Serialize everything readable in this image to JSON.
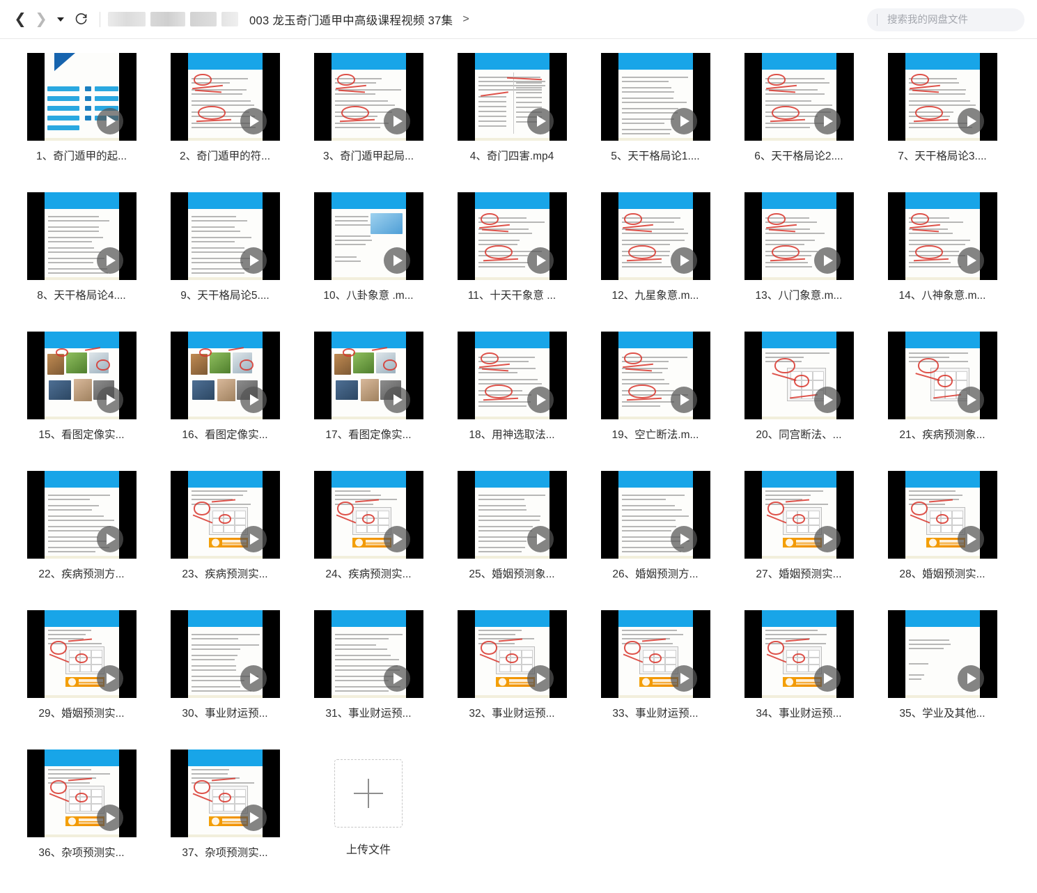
{
  "window": {
    "title": "003 龙玉奇门遁甲中高级课程视频 37集"
  },
  "toolbar": {
    "back_icon": "chevron-left-icon",
    "forward_icon": "chevron-right-icon",
    "history_caret_icon": "caret-down-icon",
    "refresh_icon": "refresh-icon",
    "breadcrumb_current": "003 龙玉奇门遁甲中高级课程视频 37集",
    "breadcrumb_next": ">",
    "path_redacted": true
  },
  "search": {
    "placeholder": "搜索我的网盘文件",
    "value": "",
    "icon": "search-input-divider"
  },
  "colors": {
    "slide_header_blue": "#18a5e8",
    "annotation_red": "#d8342a",
    "logo_orange": "#f3a008",
    "play_overlay": "#555555",
    "page_background": "#ffffff"
  },
  "upload": {
    "label": "上传文件",
    "icon": "plus-icon"
  },
  "files": [
    {
      "n": 1,
      "label": "1、奇门遁甲的起...",
      "style": "contents"
    },
    {
      "n": 2,
      "label": "2、奇门遁甲的符...",
      "style": "text-red"
    },
    {
      "n": 3,
      "label": "3、奇门遁甲起局...",
      "style": "text-red"
    },
    {
      "n": 4,
      "label": "4、奇门四害.mp4",
      "style": "two-col"
    },
    {
      "n": 5,
      "label": "5、天干格局论1....",
      "style": "text-plain"
    },
    {
      "n": 6,
      "label": "6、天干格局论2....",
      "style": "text-red"
    },
    {
      "n": 7,
      "label": "7、天干格局论3....",
      "style": "text-red"
    },
    {
      "n": 8,
      "label": "8、天干格局论4....",
      "style": "text-plain"
    },
    {
      "n": 9,
      "label": "9、天干格局论5....",
      "style": "text-plain"
    },
    {
      "n": 10,
      "label": "10、八卦象意 .m...",
      "style": "photo-sky"
    },
    {
      "n": 11,
      "label": "11、十天干象意 ...",
      "style": "text-red"
    },
    {
      "n": 12,
      "label": "12、九星象意.m...",
      "style": "text-red"
    },
    {
      "n": 13,
      "label": "13、八门象意.m...",
      "style": "text-red"
    },
    {
      "n": 14,
      "label": "14、八神象意.m...",
      "style": "text-red"
    },
    {
      "n": 15,
      "label": "15、看图定像实...",
      "style": "photo-grid"
    },
    {
      "n": 16,
      "label": "16、看图定像实...",
      "style": "photo-grid"
    },
    {
      "n": 17,
      "label": "17、看图定像实...",
      "style": "photo-grid"
    },
    {
      "n": 18,
      "label": "18、用神选取法...",
      "style": "text-red"
    },
    {
      "n": 19,
      "label": "19、空亡断法.m...",
      "style": "text-red"
    },
    {
      "n": 20,
      "label": "20、同宫断法、...",
      "style": "chart-red"
    },
    {
      "n": 21,
      "label": "21、疾病预测象...",
      "style": "chart-red"
    },
    {
      "n": 22,
      "label": "22、疾病预测方...",
      "style": "text-plain"
    },
    {
      "n": 23,
      "label": "23、疾病预测实...",
      "style": "chart-logo"
    },
    {
      "n": 24,
      "label": "24、疾病预测实...",
      "style": "chart-logo"
    },
    {
      "n": 25,
      "label": "25、婚姻预测象...",
      "style": "text-plain"
    },
    {
      "n": 26,
      "label": "26、婚姻预测方...",
      "style": "text-plain"
    },
    {
      "n": 27,
      "label": "27、婚姻预测实...",
      "style": "chart-logo"
    },
    {
      "n": 28,
      "label": "28、婚姻预测实...",
      "style": "chart-logo"
    },
    {
      "n": 29,
      "label": "29、婚姻预测实...",
      "style": "chart-logo"
    },
    {
      "n": 30,
      "label": "30、事业财运预...",
      "style": "text-plain"
    },
    {
      "n": 31,
      "label": "31、事业财运预...",
      "style": "text-plain"
    },
    {
      "n": 32,
      "label": "32、事业财运预...",
      "style": "chart-logo"
    },
    {
      "n": 33,
      "label": "33、事业财运预...",
      "style": "chart-logo"
    },
    {
      "n": 34,
      "label": "34、事业财运预...",
      "style": "chart-logo"
    },
    {
      "n": 35,
      "label": "35、学业及其他...",
      "style": "text-sparse"
    },
    {
      "n": 36,
      "label": "36、杂项预测实...",
      "style": "chart-logo"
    },
    {
      "n": 37,
      "label": "37、杂项预测实...",
      "style": "chart-logo"
    }
  ]
}
